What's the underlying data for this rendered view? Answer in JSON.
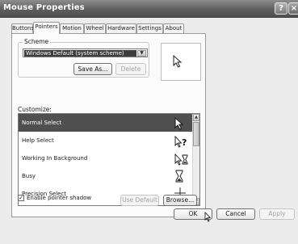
{
  "window": {
    "title": "Mouse Properties",
    "help_glyph": "?",
    "close_glyph": "×"
  },
  "tabs": [
    {
      "label": "Buttons"
    },
    {
      "label": "Pointers",
      "active": true
    },
    {
      "label": "Motion"
    },
    {
      "label": "Wheel"
    },
    {
      "label": "Hardware"
    },
    {
      "label": "Settings"
    },
    {
      "label": "About"
    }
  ],
  "scheme": {
    "label": "Scheme",
    "selected": "Windows Default (system scheme)",
    "save_as_label": "Save As...",
    "delete_label": "Delete"
  },
  "customize": {
    "label": "Customize:",
    "items": [
      {
        "label": "Normal Select",
        "icon": "arrow-pointer-icon",
        "selected": true
      },
      {
        "label": "Help Select",
        "icon": "help-pointer-icon"
      },
      {
        "label": "Working In Background",
        "icon": "working-pointer-icon"
      },
      {
        "label": "Busy",
        "icon": "hourglass-icon"
      },
      {
        "label": "Precision Select",
        "icon": "crosshair-icon"
      }
    ]
  },
  "pointer_shadow": {
    "label": "Enable pointer shadow",
    "checked": true,
    "check_glyph": "✓"
  },
  "buttons": {
    "use_default": "Use Default",
    "browse": "Browse...",
    "ok": "OK",
    "cancel": "Cancel",
    "apply": "Apply"
  }
}
